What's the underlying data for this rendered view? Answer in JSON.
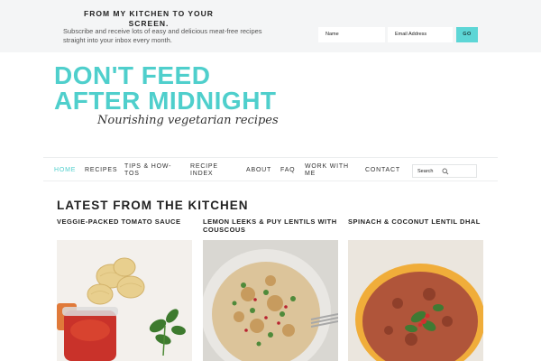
{
  "newsletter": {
    "title": "FROM MY KITCHEN TO YOUR SCREEN.",
    "description": "Subscribe and receive lots of easy and delicious meat-free recipes straight into your inbox every month.",
    "name_placeholder": "Name",
    "email_placeholder": "Email Address",
    "submit_label": "GO"
  },
  "logo": {
    "line1": "DON'T FEED",
    "line2": "AFTER MIDNIGHT",
    "tagline": "Nourishing vegetarian recipes"
  },
  "nav": {
    "items": [
      {
        "label": "HOME",
        "active": true
      },
      {
        "label": "RECIPES"
      },
      {
        "label": "TIPS & HOW-TOS"
      },
      {
        "label": "RECIPE INDEX"
      },
      {
        "label": "ABOUT"
      },
      {
        "label": "FAQ"
      },
      {
        "label": "WORK WITH ME"
      },
      {
        "label": "CONTACT"
      }
    ],
    "search_label": "Search",
    "search_icon": "search-icon"
  },
  "latest": {
    "heading": "LATEST FROM THE KITCHEN",
    "posts": [
      {
        "title": "VEGGIE-PACKED TOMATO SAUCE"
      },
      {
        "title": "LEMON LEEKS & PUY LENTILS WITH COUSCOUS"
      },
      {
        "title": "SPINACH & COCONUT LENTIL DHAL"
      }
    ]
  },
  "colors": {
    "accent": "#4fcfcc",
    "button": "#5dd6d6",
    "bar_bg": "#f4f5f6"
  }
}
